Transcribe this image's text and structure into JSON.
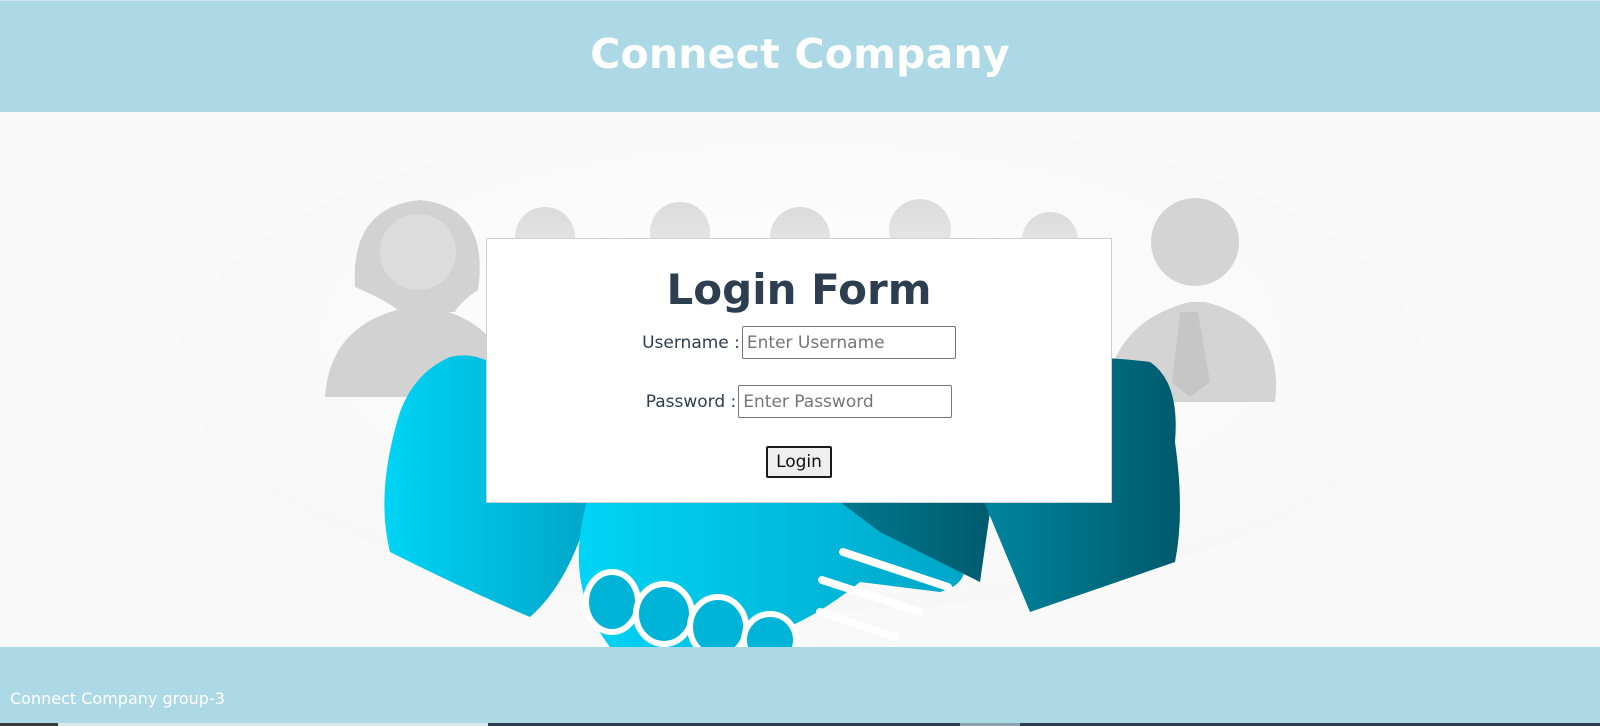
{
  "header": {
    "title": "Connect Company"
  },
  "login_form": {
    "title": "Login Form",
    "username_label": "Username :",
    "username_placeholder": "Enter Username",
    "password_label": "Password :",
    "password_placeholder": "Enter Password",
    "submit_label": "Login"
  },
  "footer": {
    "text": "Connect Company group-3"
  },
  "colors": {
    "header_bg": "#add8e6",
    "footer_bg": "#add8e6",
    "heading_text": "#2c3e50",
    "hand_left": "#00c8ec",
    "hand_right": "#006478"
  },
  "background": {
    "icon": "business-handshake-icon"
  }
}
